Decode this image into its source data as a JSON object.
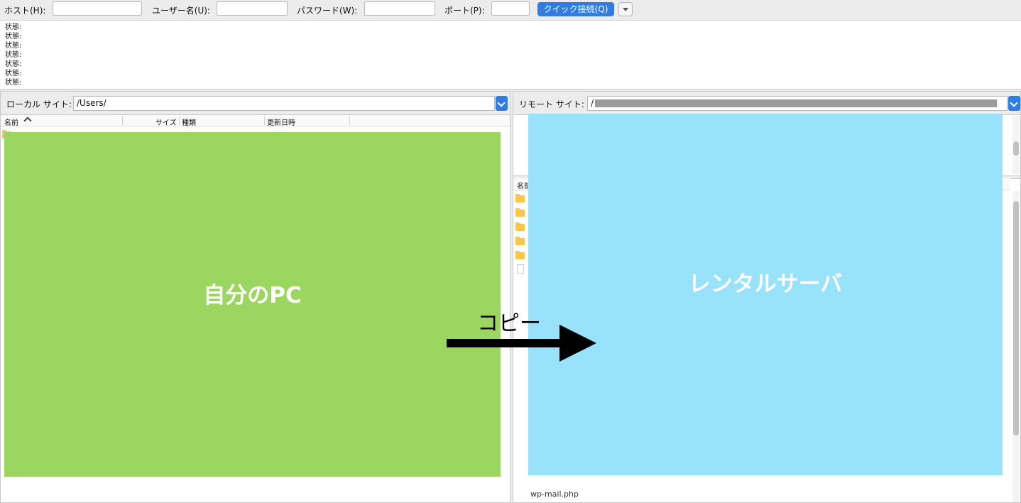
{
  "toolbar": {
    "host_label": "ホスト(H):",
    "user_label": "ユーザー名(U):",
    "password_label": "パスワード(W):",
    "port_label": "ポート(P):",
    "quickconnect_label": "クイック接続(Q)"
  },
  "log": {
    "lines": [
      "状態:",
      "状態:",
      "状態:",
      "状態:",
      "状態:",
      "状態:",
      "状態:"
    ]
  },
  "local": {
    "site_label": "ローカル サイト:",
    "path": "/Users/",
    "columns": [
      "名前",
      "サイズ",
      "種類",
      "更新日時"
    ]
  },
  "remote": {
    "site_label": "リモート サイト:",
    "path": "/",
    "column_name": "名前",
    "partial_row": "wp-mail.php"
  },
  "annotations": {
    "local_overlay": "自分のPC",
    "remote_overlay": "レンタルサーバ",
    "arrow_label": "コピー"
  },
  "colors": {
    "accent": "#2f7de1",
    "local_overlay": "#9bd661",
    "remote_overlay": "#98e3fb",
    "folder": "#f7c64a"
  }
}
